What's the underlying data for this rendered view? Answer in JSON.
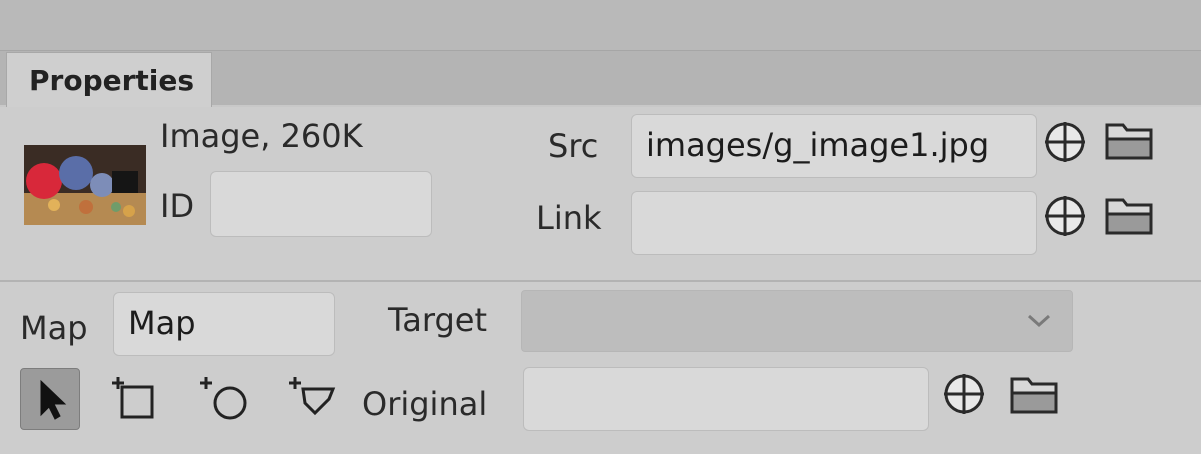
{
  "panel": {
    "tab_label": "Properties"
  },
  "image": {
    "summary": "Image, 260K",
    "id_label": "ID",
    "id_value": ""
  },
  "src": {
    "label": "Src",
    "value": "images/g_image1.jpg"
  },
  "link": {
    "label": "Link",
    "value": ""
  },
  "map": {
    "label": "Map",
    "value": "Map"
  },
  "target": {
    "label": "Target",
    "value": ""
  },
  "original": {
    "label": "Original",
    "value": ""
  },
  "icons": {
    "point_to_file": "crosshair-icon",
    "browse": "folder-icon",
    "pointer_tool": "pointer-icon",
    "rect_hotspot": "rectangle-hotspot-icon",
    "circle_hotspot": "circle-hotspot-icon",
    "polygon_hotspot": "polygon-hotspot-icon",
    "dropdown": "chevron-down-icon"
  }
}
